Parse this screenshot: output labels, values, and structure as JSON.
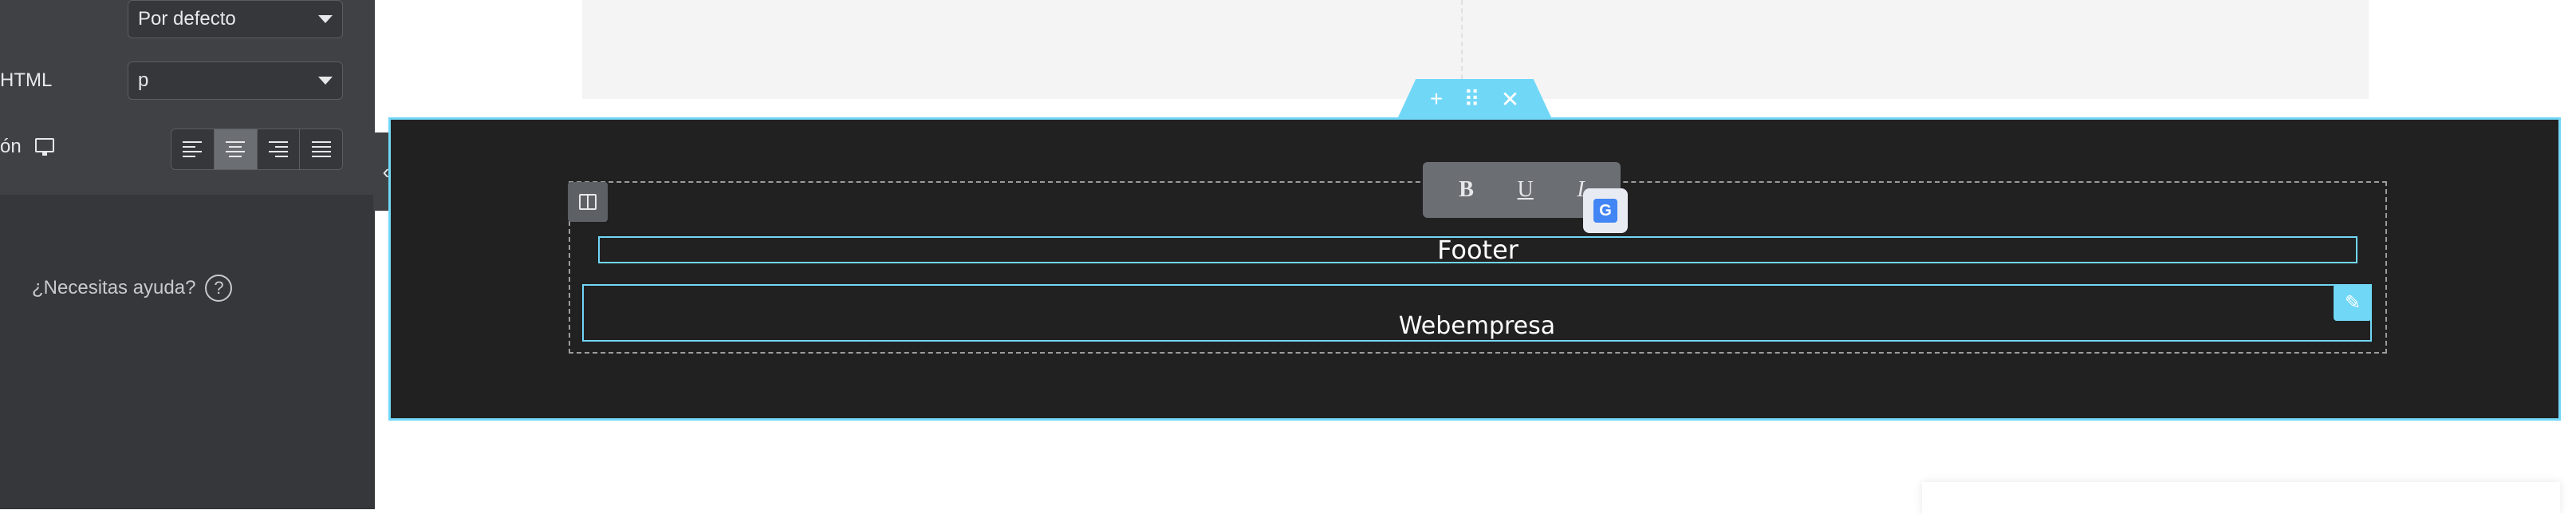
{
  "panel": {
    "tag_select_value": "Por defecto",
    "html_label": "HTML",
    "html_select_value": "p",
    "alignment_label": "ón",
    "help_text": "¿Necesitas ayuda?",
    "help_symbol": "?",
    "collapse_symbol": "‹"
  },
  "section_tab": {
    "add_symbol": "+",
    "drag_symbol": "⠿",
    "close_symbol": "✕"
  },
  "editor_toolbar": {
    "bold": "B",
    "underline": "U",
    "italic": "I",
    "translate": "G"
  },
  "content": {
    "footer_heading": "Footer",
    "text_block": "Webempresa"
  },
  "edit_symbol": "✎",
  "colors": {
    "accent": "#71d7f7",
    "section_bg": "#212121",
    "panel_bg": "#35373a"
  }
}
